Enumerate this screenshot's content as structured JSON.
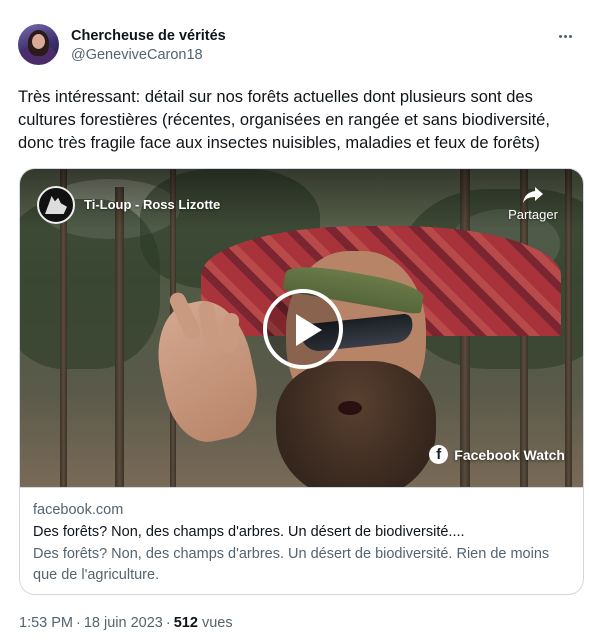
{
  "author": {
    "display_name": "Chercheuse de vérités",
    "handle": "@GeneviveCaron18"
  },
  "tweet_text": "Très intéressant: détail sur nos forêts actuelles dont plusieurs sont des cultures forestières (récentes, organisées en rangée et sans biodiversité, donc très fragile face aux insectes nuisibles, maladies et feux de forêts)",
  "card": {
    "video": {
      "channel_name": "Ti-Loup - Ross Lizotte",
      "share_label": "Partager",
      "watch_label": "Facebook Watch",
      "icons": [
        "wolf-logo-icon",
        "share-arrow-icon",
        "play-icon",
        "facebook-icon"
      ]
    },
    "domain": "facebook.com",
    "title": "Des forêts? Non, des champs d'arbres. Un désert de biodiversité....",
    "description": "Des forêts? Non, des champs d'arbres. Un désert de biodiversité. Rien de moins que de l'agriculture."
  },
  "meta": {
    "time": "1:53 PM",
    "date": "18 juin 2023",
    "views_count": "512",
    "views_label": "vues"
  },
  "colors": {
    "text_primary": "#0f1419",
    "text_secondary": "#536471",
    "border": "#cfd9de"
  }
}
